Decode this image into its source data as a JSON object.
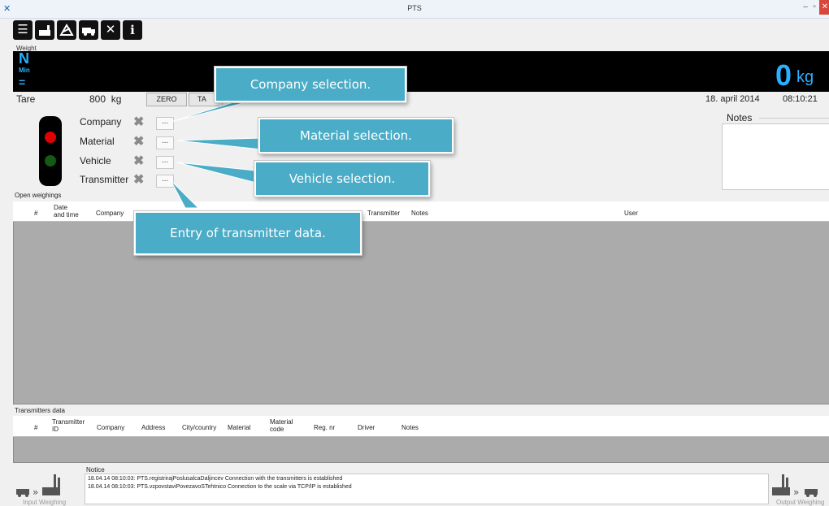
{
  "window": {
    "title": "PTS"
  },
  "toolbar": {
    "icons": [
      "list-icon",
      "factory-icon",
      "scale-icon",
      "truck-icon",
      "tools-icon",
      "info-icon"
    ]
  },
  "weight": {
    "label": "Weight",
    "indicator_n": "N",
    "indicator_min": "Min",
    "indicator_eq": "=",
    "value": "0",
    "unit": "kg"
  },
  "tare": {
    "label": "Tare",
    "value": "800  kg",
    "zero_button": "ZERO",
    "tare_button": "TA"
  },
  "datetime": {
    "date": "18. april 2014",
    "time": "08:10:21"
  },
  "selection": {
    "company": "Company",
    "material": "Material",
    "vehicle": "Vehicle",
    "transmitter": "Transmitter",
    "dots": "..."
  },
  "notes": {
    "label": "Notes"
  },
  "callouts": {
    "company": "Company selection.",
    "material": "Material selection.",
    "vehicle": "Vehicle selection.",
    "transmitter": "Entry of transmitter data."
  },
  "open_weighings": {
    "label": "Open weighings",
    "columns": [
      "#",
      "Date\nand time",
      "Company",
      "Transmitter",
      "Notes",
      "User"
    ]
  },
  "transmitters_data": {
    "label": "Transmitters data",
    "columns": [
      "#",
      "Transmitter\nID",
      "Company",
      "Address",
      "City/country",
      "Material",
      "Material\ncode",
      "Reg. nr",
      "Driver",
      "Notes"
    ]
  },
  "notice": {
    "label": "Notice",
    "lines": [
      "18.04.14 08:10:03: PTS.registrirajPoslusalcaDaljincev Connection with the transmitters is established",
      "18.04.14 08:10:03: PTS.vzpovstaviPovezavoSTehtnico Connection to the scale via TCP/IP is established"
    ]
  },
  "footer": {
    "input_weighing": "Input Weighing",
    "output_weighing": "Output Weighing"
  },
  "colors": {
    "display_bg": "#000000",
    "display_text": "#2ab0ff",
    "callout_bg": "#4aacc6",
    "grid_bg": "#ababab",
    "red_light": "#e00000",
    "green_light": "#145a14"
  }
}
